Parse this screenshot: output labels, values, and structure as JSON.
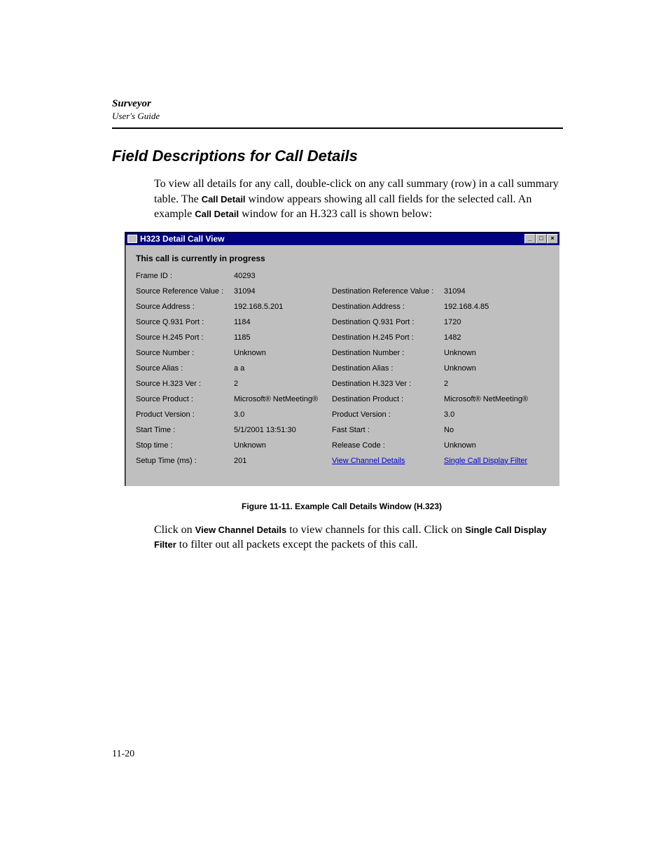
{
  "header": {
    "product": "Surveyor",
    "guide": "User's Guide"
  },
  "section_title": "Field Descriptions for Call Details",
  "intro": {
    "t1": "To view all details for any call, double-click on any call summary (row) in a call summary table. The ",
    "b1": "Call Detail",
    "t2": " window appears showing all call fields for the selected call. An example ",
    "b2": "Call Detail",
    "t3": " window for an H.323 call is shown below:"
  },
  "window": {
    "title": "H323 Detail Call View",
    "status": "This call is currently in progress",
    "rows": [
      [
        "Frame ID :",
        "40293",
        "",
        ""
      ],
      [
        "Source Reference Value :",
        "31094",
        "Destination Reference Value :",
        "31094"
      ],
      [
        "Source Address :",
        "192.168.5.201",
        "Destination Address :",
        "192.168.4.85"
      ],
      [
        "Source Q.931 Port :",
        "1184",
        "Destination Q.931 Port :",
        "1720"
      ],
      [
        "Source H.245 Port :",
        "1185",
        "Destination H.245 Port :",
        "1482"
      ],
      [
        "Source Number :",
        "Unknown",
        "Destination Number :",
        "Unknown"
      ],
      [
        "Source Alias :",
        "a a",
        "Destination Alias :",
        "Unknown"
      ],
      [
        "Source H.323 Ver :",
        "2",
        "Destination H.323 Ver :",
        "2"
      ],
      [
        "Source Product :",
        "Microsoft® NetMeeting®",
        "Destination Product :",
        "Microsoft® NetMeeting®"
      ],
      [
        "Product Version :",
        "3.0",
        "Product Version :",
        "3.0"
      ],
      [
        "Start Time :",
        "5/1/2001  13:51:30",
        "Fast Start :",
        "No"
      ],
      [
        "Stop time :",
        "Unknown",
        "Release Code :",
        "Unknown"
      ]
    ],
    "lastrow": {
      "l1": "Setup Time (ms) :",
      "l2": "201",
      "link1": "View Channel Details",
      "link2": "Single Call Display Filter"
    }
  },
  "caption": "Figure 11-11.  Example Call Details Window (H.323)",
  "outro": {
    "t1": "Click on ",
    "b1": "View Channel Details",
    "t2": " to view channels for this call. Click on ",
    "b2": "Single Call Display Filter",
    "t3": " to filter out all packets except the packets of this call."
  },
  "page_num": "11-20",
  "win_btns": {
    "min": "_",
    "max": "□",
    "close": "×"
  }
}
